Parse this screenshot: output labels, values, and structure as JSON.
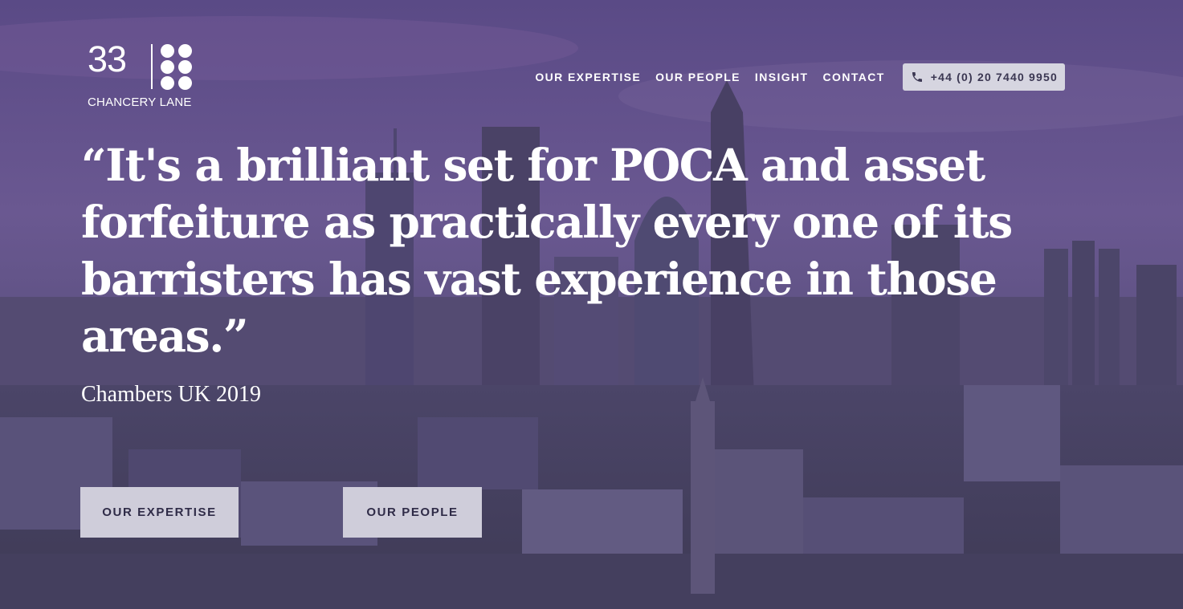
{
  "header": {
    "logo": {
      "number": "33",
      "subtitle": "CHANCERY LANE"
    },
    "nav": {
      "items": [
        {
          "label": "OUR EXPERTISE"
        },
        {
          "label": "OUR PEOPLE"
        },
        {
          "label": "INSIGHT"
        },
        {
          "label": "CONTACT"
        }
      ],
      "phone": {
        "icon": "phone-icon",
        "label": "+44 (0) 20 7440 9950"
      }
    }
  },
  "hero": {
    "background": "city-skyline-dusk-photo",
    "quote": "“It's a brilliant set for POCA and asset forfeiture as practically every one of its barristers has vast experience in those areas.”",
    "attribution": "Chambers UK 2019",
    "buttons": [
      {
        "label": "OUR EXPERTISE"
      },
      {
        "label": "OUR PEOPLE"
      }
    ]
  },
  "colors": {
    "overlay": "#4f4675",
    "button_bg": "#cfcdda",
    "button_text": "#2f2b47",
    "text": "#ffffff"
  }
}
